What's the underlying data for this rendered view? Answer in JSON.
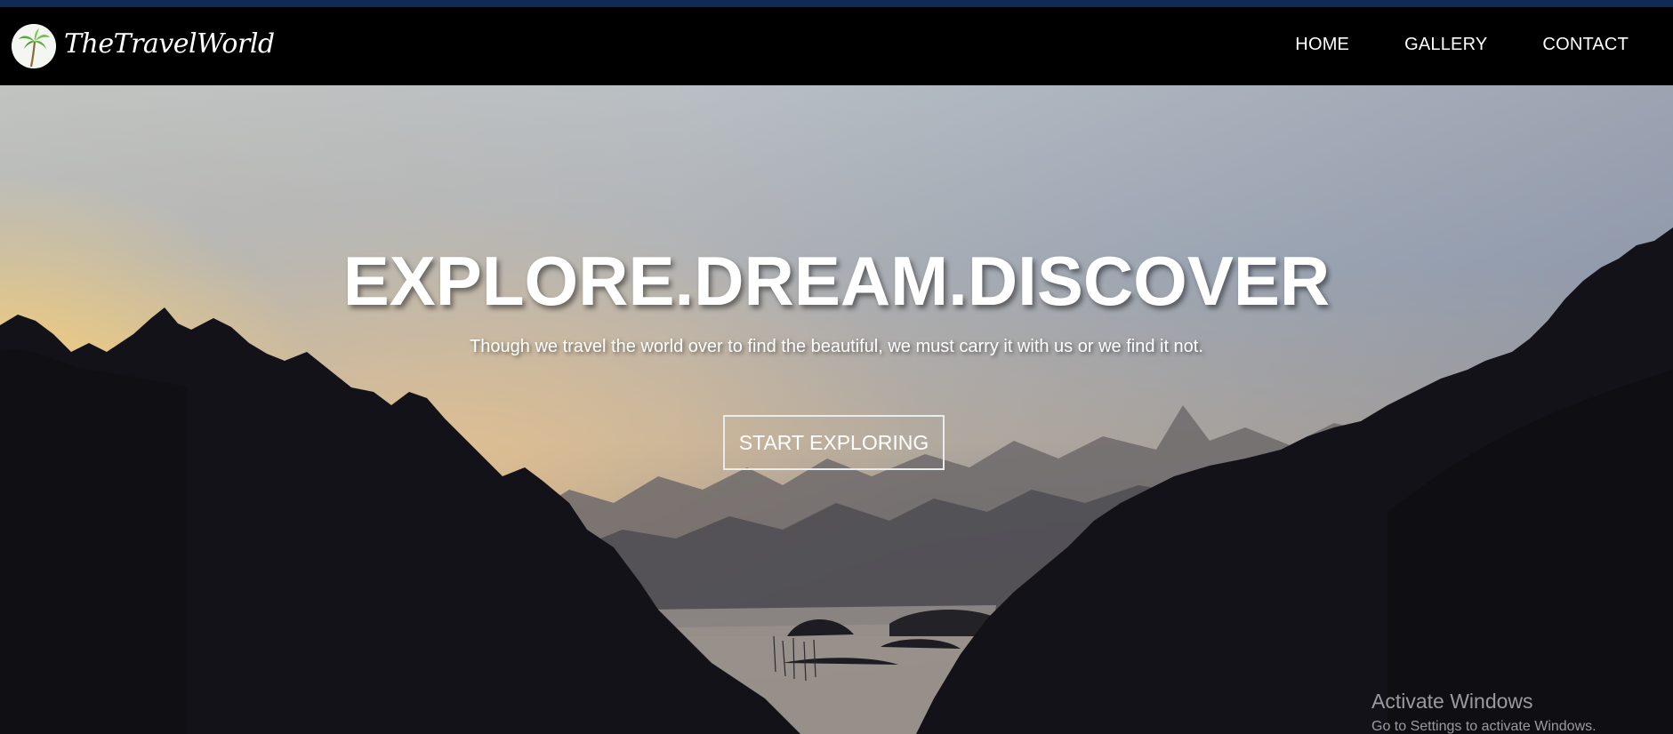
{
  "brand": {
    "name": "TheTravelWorld",
    "logo_icon": "palm-tree-icon"
  },
  "nav": {
    "items": [
      "HOME",
      "GALLERY",
      "CONTACT"
    ]
  },
  "hero": {
    "headline": "EXPLORE.DREAM.DISCOVER",
    "subline": "Though we travel the world over to find the beautiful, we must carry it with us or we find it not.",
    "cta_label": "START EXPLORING"
  },
  "watermark": {
    "title": "Activate Windows",
    "subtitle": "Go to Settings to activate Windows."
  },
  "colors": {
    "top_strip": "#0f2a57",
    "navbar": "#000000",
    "text": "#ffffff"
  }
}
